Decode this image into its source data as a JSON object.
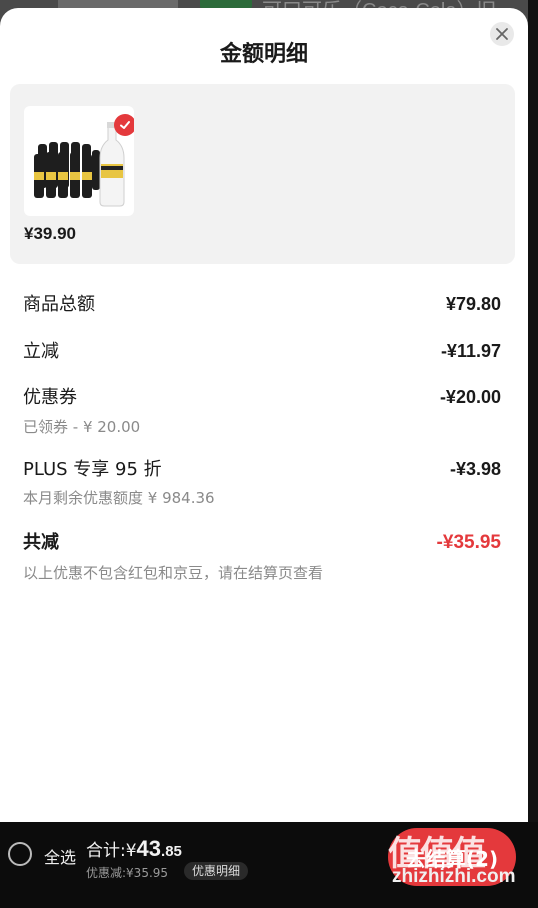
{
  "background": {
    "partial_title": "可口可乐（Coca-Cola）旧"
  },
  "sheet": {
    "title": "金额明细",
    "close_icon": "close-icon"
  },
  "product": {
    "price": "¥39.90",
    "selected": true
  },
  "rows": {
    "goods_total": {
      "label": "商品总额",
      "value": "¥79.80"
    },
    "instant_discount": {
      "label": "立减",
      "value": "-¥11.97"
    },
    "coupon": {
      "label": "优惠券",
      "value": "-¥20.00",
      "note": "已领券 - ¥ 20.00"
    },
    "plus": {
      "label": "PLUS 专享 95 折",
      "value": "-¥3.98",
      "note": "本月剩余优惠额度 ¥ 984.36"
    },
    "total_discount": {
      "label": "共减",
      "value": "-¥35.95",
      "note": "以上优惠不包含红包和京豆，请在结算页查看"
    }
  },
  "bottom_bar": {
    "select_all": "全选",
    "total_prefix": "合计:¥",
    "total_int": "43",
    "total_dec": ".85",
    "discount_text": "优惠减:¥35.95",
    "detail_chip": "优惠明细",
    "checkout": "去结算(2)"
  },
  "watermark": {
    "logo": "值值值",
    "site": "zhizhizhi.com"
  },
  "colors": {
    "accent_red": "#e4393c",
    "sheet_bg": "#ffffff",
    "card_bg": "#f2f2f2",
    "bar_bg": "#0c0c0c"
  }
}
